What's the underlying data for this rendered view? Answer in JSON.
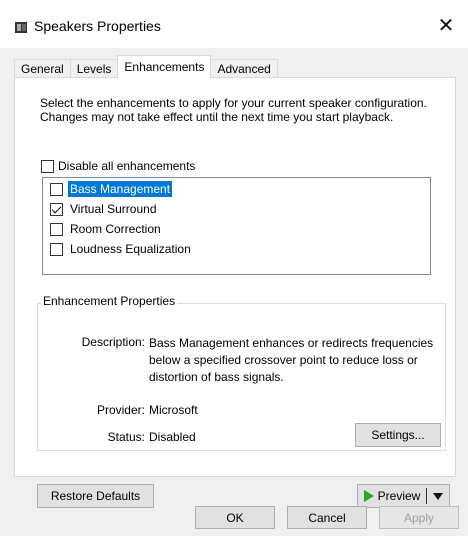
{
  "window": {
    "title": "Speakers Properties",
    "close_glyph": "✕"
  },
  "tabs": [
    "General",
    "Levels",
    "Enhancements",
    "Advanced"
  ],
  "active_tab": "Enhancements",
  "enhancements": {
    "instructions": "Select the enhancements to apply for your current speaker configuration. Changes may not take effect until the next time you start playback.",
    "disable_all": {
      "label": "Disable all enhancements",
      "checked": false
    },
    "items": [
      {
        "label": "Bass Management",
        "checked": false,
        "selected": true
      },
      {
        "label": "Virtual Surround",
        "checked": true,
        "selected": false
      },
      {
        "label": "Room Correction",
        "checked": false,
        "selected": false
      },
      {
        "label": "Loudness Equalization",
        "checked": false,
        "selected": false
      }
    ]
  },
  "properties": {
    "group_title": "Enhancement Properties",
    "description_label": "Description:",
    "description_value": "Bass Management enhances or redirects frequencies below a specified crossover point to reduce loss or distortion of bass signals.",
    "provider_label": "Provider:",
    "provider_value": "Microsoft",
    "status_label": "Status:",
    "status_value": "Disabled",
    "settings_label": "Settings..."
  },
  "buttons": {
    "restore_defaults": "Restore Defaults",
    "preview": "Preview",
    "ok": "OK",
    "cancel": "Cancel",
    "apply": "Apply"
  },
  "icons": {
    "window_icon": "speaker-icon",
    "preview_icon": "play-icon",
    "preview_menu": "chevron-down-icon"
  }
}
